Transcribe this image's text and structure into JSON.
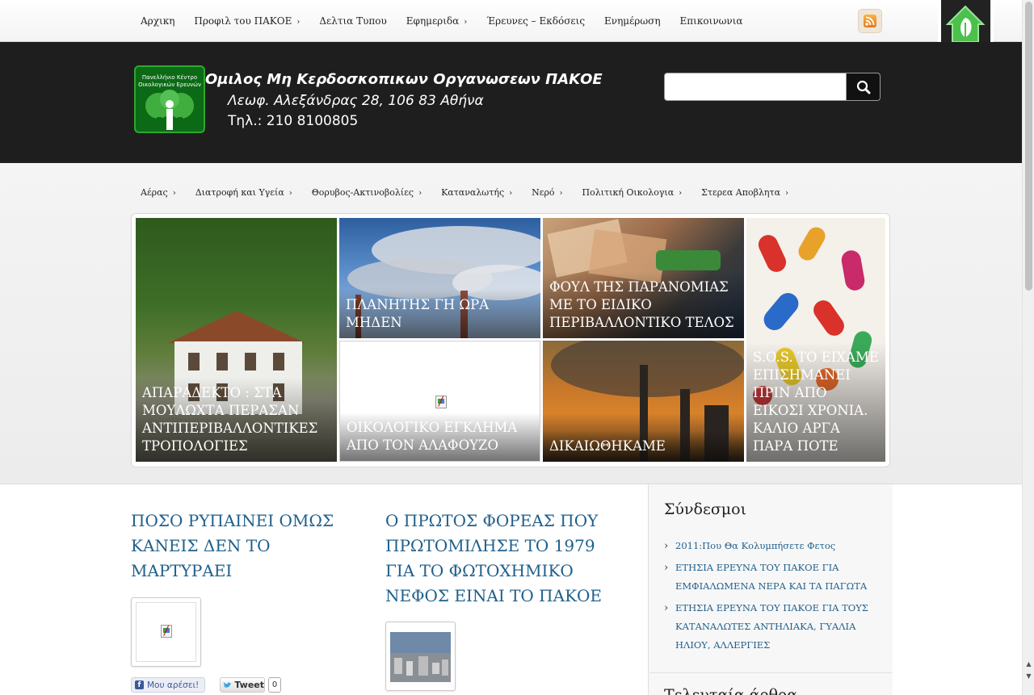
{
  "top_nav": [
    {
      "label": "Αρχικη",
      "has_submenu": false
    },
    {
      "label": "Προφιλ του ΠΑΚΟΕ",
      "has_submenu": true
    },
    {
      "label": "Δελτια Τυπου",
      "has_submenu": false
    },
    {
      "label": "Εφημεριδα",
      "has_submenu": true
    },
    {
      "label": "Έρευνες – Εκδόσεις",
      "has_submenu": false
    },
    {
      "label": "Ενημέρωση",
      "has_submenu": false
    },
    {
      "label": "Επικοινωνια",
      "has_submenu": false
    }
  ],
  "submenu_arrow": "›",
  "header": {
    "title": "Ομιλος Μη Κερδοσκοπικων Οργανωσεων ΠΑΚΟΕ",
    "address": "Λεωφ. Αλεξάνδρας 28, 106 83 Αθήνα",
    "phone": "Τηλ.: 210 8100805",
    "logo_line1": "Πανελλήνιο Κέντρο",
    "logo_line2": "Οικολογικών Ερευνών"
  },
  "search": {
    "value": "",
    "placeholder": ""
  },
  "category_nav": [
    {
      "label": "Αέρας"
    },
    {
      "label": "Διατροφή και Υγεία"
    },
    {
      "label": "Θορυβος-Ακτινοβολίες"
    },
    {
      "label": "Καταναλωτής"
    },
    {
      "label": "Νερό"
    },
    {
      "label": "Πολιτική Οικολογια"
    },
    {
      "label": "Στερεα Αποβλητα"
    }
  ],
  "featured": [
    {
      "caption": "ΑΠΑΡΑΔΕΚΤΟ : ΣΤΑ ΜΟΥΛΩΧΤΑ ΠΕΡΑΣΑΝ ΑΝΤΙΠΕΡΙΒΑΛΛΟΝΤΙΚΕΣ ΤΡΟΠΟΛΟΓΙΕΣ",
      "image": "village-house-forest"
    },
    {
      "caption": "ΠΛΑΝΗΤΗΣ ΓΗ ΩΡΑ ΜΗΔΕΝ",
      "image": "smokestacks-sky"
    },
    {
      "caption": "ΦΟΥΛ ΤΗΣ ΠΑΡΑΝΟΜΙΑΣ ΜΕ ΤΟ ΕΙΔΙΚΟ ΠΕΡΙΒΑΛΛΟΝΤΙΚΟ ΤΕΛΟΣ",
      "image": "euro-fuel-pump"
    },
    {
      "caption": "ΟΙΚΟΛΟΓΙΚΟ ΕΓΚΛΗΜΑ ΑΠΟ ΤΟΝ ΑΛΑΦΟΥΖΟ",
      "image": "broken-image"
    },
    {
      "caption": "ΔΙΚΑΙΩΘΗΚΑΜΕ",
      "image": "factory-smoke"
    },
    {
      "caption": "S.O.S. ΤΟ ΕΙΧΑΜΕ ΕΠΙΣΗΜΑΝΕΙ ΠΡΙΝ ΑΠΟ ΕΙΚΟΣΙ ΧΡΟΝΙΑ. ΚΑΛΙΟ ΑΡΓΑ ΠΑΡΑ ΠΟΤΕ",
      "image": "pills"
    }
  ],
  "posts": [
    {
      "title": "ΠΟΣΟ ΡΥΠΑΙΝΕΙ ΟΜΩΣ ΚΑΝΕΙΣ ΔΕΝ ΤΟ ΜΑΡΤΥΡΑΕΙ",
      "thumb": "broken-image"
    },
    {
      "title": "Ο ΠΡΩΤΟΣ ΦΟΡΕΑΣ ΠΟΥ ΠΡΩΤΟΜΙΛΗΣΕ ΤΟ 1979 ΓΙΑ ΤΟ ΦΩΤΟΧΗΜΙΚΟ ΝΕΦΟΣ ΕΙΝΑΙ ΤΟ ΠΑΚΟΕ",
      "thumb": "city-smog"
    }
  ],
  "social": {
    "like_label": "Μου αρέσει!",
    "tweet_label": "Tweet",
    "tweet_count": "0"
  },
  "sidebar": {
    "title": "Σύνδεσμοι",
    "links": [
      "2011:Που Θα Κολυμπήσετε Φετος",
      "ΕΤΗΣΙΑ ΕΡΕΥΝΑ ΤΟΥ ΠΑΚΟΕ ΓΙΑ ΕΜΦΙΑΛΩΜΕΝΑ ΝΕΡΑ ΚΑΙ ΤΑ ΠΑΓΩΤΑ",
      "ΕΤΗΣΙΑ ΕΡΕΥΝΑ ΤΟΥ ΠΑΚΟΕ ΓΙΑ ΤΟΥΣ ΚΑΤΑΝΑΛΩΤΕΣ ΑΝΤΗΛΙΑΚΑ, ΓΥΑΛΙΑ ΗΛΙΟΥ, ΑΛΛΕΡΓΙΕΣ"
    ],
    "next_title": "Τελευταία άρθρα"
  },
  "colors": {
    "link_blue": "#1f5f8b",
    "header_bg": "#1e1e1e",
    "logo_green": "#2ea82e"
  }
}
